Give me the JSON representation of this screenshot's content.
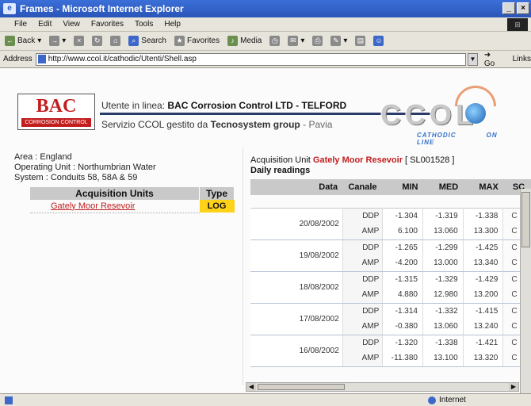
{
  "window": {
    "title": "Frames - Microsoft Internet Explorer",
    "controls": [
      "_",
      "×"
    ]
  },
  "menu": [
    "File",
    "Edit",
    "View",
    "Favorites",
    "Tools",
    "Help"
  ],
  "toolbar": {
    "back": "Back",
    "search": "Search",
    "favorites": "Favorites",
    "media": "Media"
  },
  "address": {
    "label": "Address",
    "url": "http://www.ccol.it/cathodic/Utenti/Shell.asp",
    "go": "Go",
    "links": "Links"
  },
  "header": {
    "bac_logo": "BAC",
    "bac_sub": "CORROSION CONTROL",
    "utente_prefix": "Utente in linea:",
    "utente_name": "BAC Corrosion Control LTD - TELFORD",
    "servizio_prefix": "Servizio CCOL gestito da",
    "servizio_company": "Tecnosystem group",
    "servizio_city": "- Pavia",
    "ccol_logo": "CCOL",
    "ccol_tag1": "CATHODIC",
    "ccol_tag2": "ON LINE"
  },
  "left": {
    "area": "Area : England",
    "operating_unit": "Operating Unit : Northumbrian Water",
    "system": "System : Conduits 58, 58A & 59",
    "col_units": "Acquisition Units",
    "col_type": "Type",
    "units": [
      {
        "name": "Gately Moor Resevoir",
        "type": "LOG"
      }
    ]
  },
  "right": {
    "acq_prefix": "Acquisition Unit",
    "acq_name": "Gately Moor Resevoir",
    "acq_code": "[ SL001528 ]",
    "daily": "Daily readings",
    "columns": [
      "Data",
      "Canale",
      "MIN",
      "MED",
      "MAX",
      "SC"
    ],
    "readings": [
      {
        "date": "20/08/2002",
        "rows": [
          {
            "ch": "DDP",
            "min": "-1.304",
            "med": "-1.319",
            "max": "-1.338",
            "sc": "C"
          },
          {
            "ch": "AMP",
            "min": "6.100",
            "med": "13.060",
            "max": "13.300",
            "sc": "C"
          }
        ]
      },
      {
        "date": "19/08/2002",
        "rows": [
          {
            "ch": "DDP",
            "min": "-1.265",
            "med": "-1.299",
            "max": "-1.425",
            "sc": "C"
          },
          {
            "ch": "AMP",
            "min": "-4.200",
            "med": "13.000",
            "max": "13.340",
            "sc": "C"
          }
        ]
      },
      {
        "date": "18/08/2002",
        "rows": [
          {
            "ch": "DDP",
            "min": "-1.315",
            "med": "-1.329",
            "max": "-1.429",
            "sc": "C"
          },
          {
            "ch": "AMP",
            "min": "4.880",
            "med": "12.980",
            "max": "13.200",
            "sc": "C"
          }
        ]
      },
      {
        "date": "17/08/2002",
        "rows": [
          {
            "ch": "DDP",
            "min": "-1.314",
            "med": "-1.332",
            "max": "-1.415",
            "sc": "C"
          },
          {
            "ch": "AMP",
            "min": "-0.380",
            "med": "13.060",
            "max": "13.240",
            "sc": "C"
          }
        ]
      },
      {
        "date": "16/08/2002",
        "rows": [
          {
            "ch": "DDP",
            "min": "-1.320",
            "med": "-1.338",
            "max": "-1.421",
            "sc": "C"
          },
          {
            "ch": "AMP",
            "min": "-11.380",
            "med": "13.100",
            "max": "13.320",
            "sc": "C"
          }
        ]
      }
    ]
  },
  "status": {
    "zone": "Internet"
  }
}
